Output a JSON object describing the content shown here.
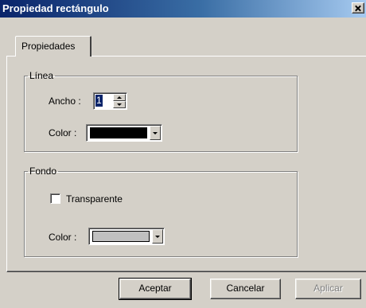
{
  "window": {
    "title": "Propiedad rectángulo",
    "close_icon": "close-icon"
  },
  "tabs": [
    {
      "label": "Propiedades",
      "selected": true
    }
  ],
  "line_group": {
    "legend": "Línea",
    "width_label": "Ancho :",
    "width_value": "1",
    "color_label": "Color :",
    "color_value": "#000000"
  },
  "fill_group": {
    "legend": "Fondo",
    "transparent_label": "Transparente",
    "transparent_checked": false,
    "color_label": "Color :",
    "color_value": "#c0c0c0"
  },
  "buttons": {
    "ok": "Aceptar",
    "cancel": "Cancelar",
    "apply": "Aplicar",
    "apply_enabled": false
  }
}
